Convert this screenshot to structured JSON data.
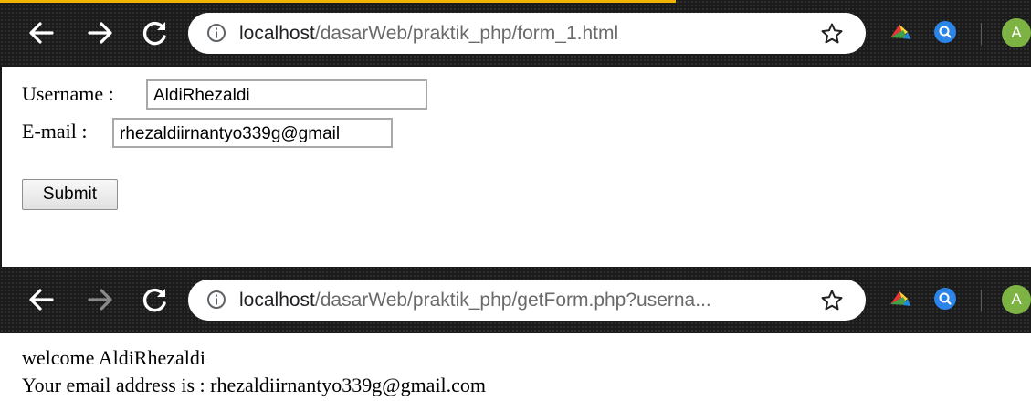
{
  "top_window": {
    "url_host": "localhost",
    "url_path": "/dasarWeb/praktik_php/form_1.html",
    "form": {
      "username_label": "Username :",
      "username_value": "AldiRhezaldi",
      "email_label": "E-mail :",
      "email_value": "rhezaldiirnantyo339g@gmail",
      "submit_label": "Submit"
    }
  },
  "bottom_window": {
    "url_host": "localhost",
    "url_path": "/dasarWeb/praktik_php/getForm.php?userna...",
    "welcome_text": "welcome AldiRhezaldi",
    "email_text": "Your email address is : rhezaldiirnantyo339g@gmail.com"
  },
  "profile_avatar": {
    "initial": "A",
    "color": "#7cb342"
  },
  "icons": [
    "back-arrow-icon",
    "forward-arrow-icon",
    "reload-icon",
    "info-icon",
    "star-icon",
    "extension-icon",
    "search-extension-icon"
  ],
  "colors": {
    "toolbar": "#1b1b1b",
    "top_accent": "#f0b400",
    "omnibox": "#ffffff",
    "url_host": "#202124",
    "url_path": "#6a6a6a"
  }
}
